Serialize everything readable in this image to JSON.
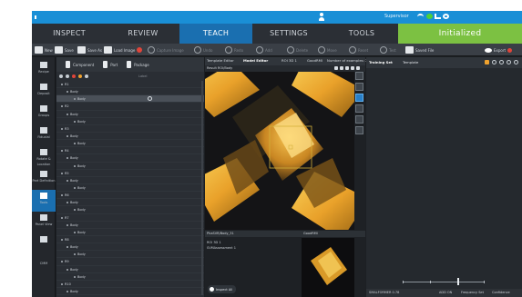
{
  "titlebar": {
    "user": "Supervisor"
  },
  "tabs": [
    {
      "label": "INSPECT"
    },
    {
      "label": "REVIEW"
    },
    {
      "label": "TEACH"
    },
    {
      "label": "SETTINGS"
    },
    {
      "label": "TOOLS"
    },
    {
      "label": "Initialized"
    }
  ],
  "toolbar": {
    "new": "New",
    "save": "Save",
    "save_as": "Save As",
    "load_image": "Load Image",
    "capture_image": "Capture Image",
    "buttons": [
      "Undo",
      "Redo",
      "Add",
      "Delete",
      "Move",
      "Reset",
      "Test"
    ],
    "saved_file": "Saved File",
    "export": "Export"
  },
  "leftnav": [
    "Recipe",
    "Deposit",
    "Groups",
    "Fiducial",
    "Rotate &\nLocation",
    "Part\nDefinition",
    "Tools",
    "Panel\nView",
    "",
    "CMM"
  ],
  "tree": {
    "buttons": [
      "Component",
      "Part",
      "Package"
    ],
    "column": "Label",
    "rows": [
      {
        "label": "R1",
        "level": 0
      },
      {
        "label": "Body",
        "level": 1
      },
      {
        "label": "Body",
        "level": 2,
        "selected": true
      },
      {
        "label": "R2",
        "level": 0
      },
      {
        "label": "Body",
        "level": 1
      },
      {
        "label": "Body",
        "level": 2
      },
      {
        "label": "R3",
        "level": 0
      },
      {
        "label": "Body",
        "level": 1
      },
      {
        "label": "Body",
        "level": 2
      },
      {
        "label": "R4",
        "level": 0
      },
      {
        "label": "Body",
        "level": 1
      },
      {
        "label": "Body",
        "level": 2
      },
      {
        "label": "R5",
        "level": 0
      },
      {
        "label": "Body",
        "level": 1
      },
      {
        "label": "Body",
        "level": 2
      },
      {
        "label": "R6",
        "level": 0
      },
      {
        "label": "Body",
        "level": 1
      },
      {
        "label": "Body",
        "level": 2
      },
      {
        "label": "R7",
        "level": 0
      },
      {
        "label": "Body",
        "level": 1
      },
      {
        "label": "Body",
        "level": 2
      },
      {
        "label": "R8",
        "level": 0
      },
      {
        "label": "Body",
        "level": 1
      },
      {
        "label": "Body",
        "level": 2
      },
      {
        "label": "R9",
        "level": 0
      },
      {
        "label": "Body",
        "level": 1
      },
      {
        "label": "Body",
        "level": 2
      },
      {
        "label": "R10",
        "level": 0
      },
      {
        "label": "Body",
        "level": 1
      }
    ]
  },
  "center": {
    "tabs": [
      "Template Editor",
      "Model Editor",
      "ROI 3D 1",
      "GoodRMI",
      "Number of examples: 25"
    ],
    "title": "Result ROI/Body",
    "bottom_title": "PhaSVR/Body_31",
    "bottom_score": "GoodRMI",
    "bottom_info": [
      "ROI 3D 1",
      "SVMAssessment 1"
    ],
    "inspect_all": "Inspect All"
  },
  "right": {
    "tabs": [
      "Training Set",
      "Template"
    ],
    "footer": [
      "SMALFORMER 0.78",
      "ADD ON",
      "Frequency Set",
      "Confidence"
    ]
  }
}
